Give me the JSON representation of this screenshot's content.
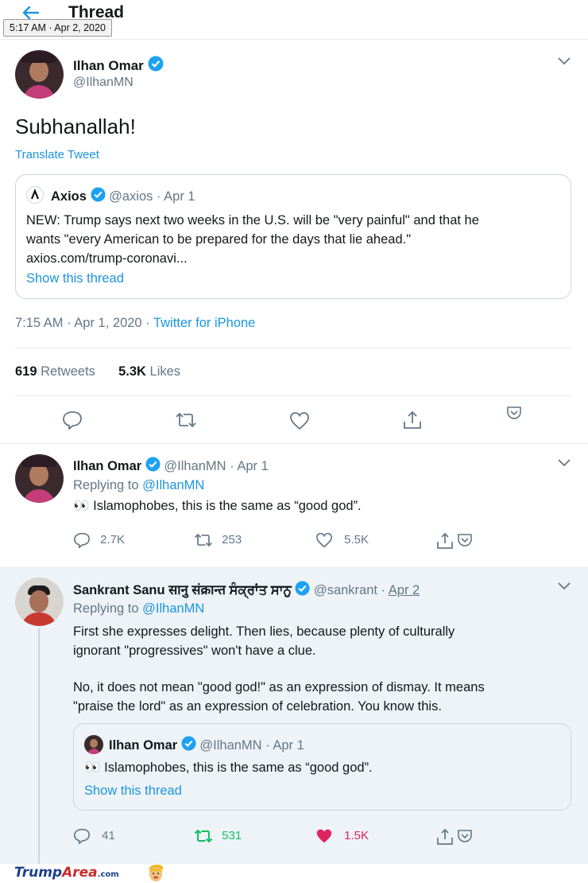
{
  "header": {
    "title": "Thread",
    "tooltip": "5:17 AM · Apr 2, 2020"
  },
  "main_tweet": {
    "name": "Ilhan Omar",
    "handle": "@IlhanMN",
    "text": "Subhanallah!",
    "translate": "Translate Tweet",
    "quote": {
      "name": "Axios",
      "handle": "@axios",
      "date": "· Apr 1",
      "text_line1": "NEW: Trump says next two weeks in the U.S. will be \"very painful\" and that he",
      "text_line2": "wants \"every American to be prepared for the days that lie ahead.\"",
      "text_line3": "axios.com/trump-coronavi...",
      "show_thread": "Show this thread"
    },
    "timestamp": "7:15 AM · Apr 1, 2020 · ",
    "source": "Twitter for iPhone",
    "retweets_count": "619",
    "retweets_label": "Retweets",
    "likes_count": "5.3K",
    "likes_label": "Likes"
  },
  "reply1": {
    "name": "Ilhan Omar",
    "handle": "@IlhanMN",
    "date": "· Apr 1",
    "replying_prefix": "Replying to",
    "replying_to": "@IlhanMN",
    "text": "👀 Islamophobes, this is the same as “good god”.",
    "replies": "2.7K",
    "retweets": "253",
    "likes": "5.5K"
  },
  "reply2": {
    "name": "Sankrant Sanu सानु संक्रान्त ਸੰਕ੍ਰਾਂਤ ਸਾਨੁ",
    "handle": "@sankrant",
    "date_prefix": "·",
    "date": "Apr 2",
    "replying_prefix": "Replying to",
    "replying_to": "@IlhanMN",
    "text_line1": "First she expresses delight. Then lies, because plenty of culturally",
    "text_line2": "ignorant \"progressives\" won't have a clue.",
    "text_line3": "No, it does not mean \"good god!\" as an expression of dismay. It means",
    "text_line4": "\"praise the lord\" as an expression of celebration. You know this.",
    "quote": {
      "name": "Ilhan Omar",
      "handle": "@IlhanMN",
      "date": "· Apr 1",
      "text": "👀 Islamophobes, this is the same as “good god”.",
      "show_thread": "Show this thread"
    },
    "replies": "41",
    "retweets": "531",
    "likes": "1.5K"
  },
  "watermark": {
    "trump": "Trump",
    "area": "Area",
    "com": ".com"
  },
  "colors": {
    "link_blue": "#1b95e0",
    "retweet_green": "#17bf63",
    "like_red": "#e0245e",
    "reply_bg": "#eef3f8"
  }
}
